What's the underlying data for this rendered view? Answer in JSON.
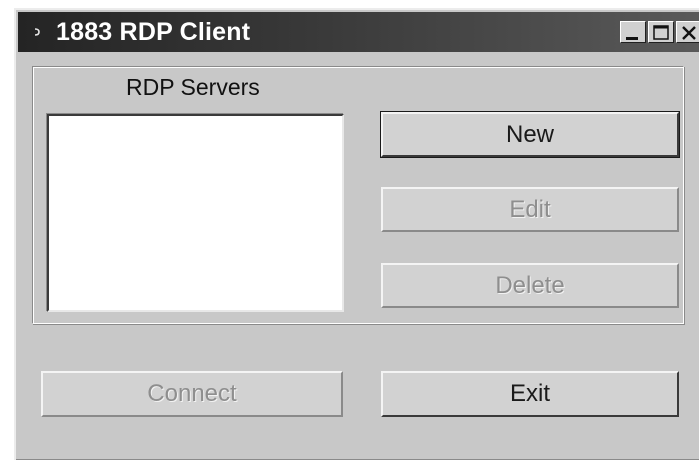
{
  "window": {
    "title": "1883 RDP Client",
    "system_icon": "app-menu-icon"
  },
  "title_buttons": {
    "minimize": "minimize-icon",
    "maximize": "maximize-icon",
    "close": "close-icon"
  },
  "servers": {
    "group_label": "RDP Servers",
    "items": []
  },
  "buttons": {
    "new": "New",
    "edit": "Edit",
    "delete": "Delete",
    "connect": "Connect",
    "exit": "Exit"
  },
  "colors": {
    "titlebar": "#242424",
    "face": "#c8c8c8",
    "disabled_text": "#8e8e8e"
  }
}
